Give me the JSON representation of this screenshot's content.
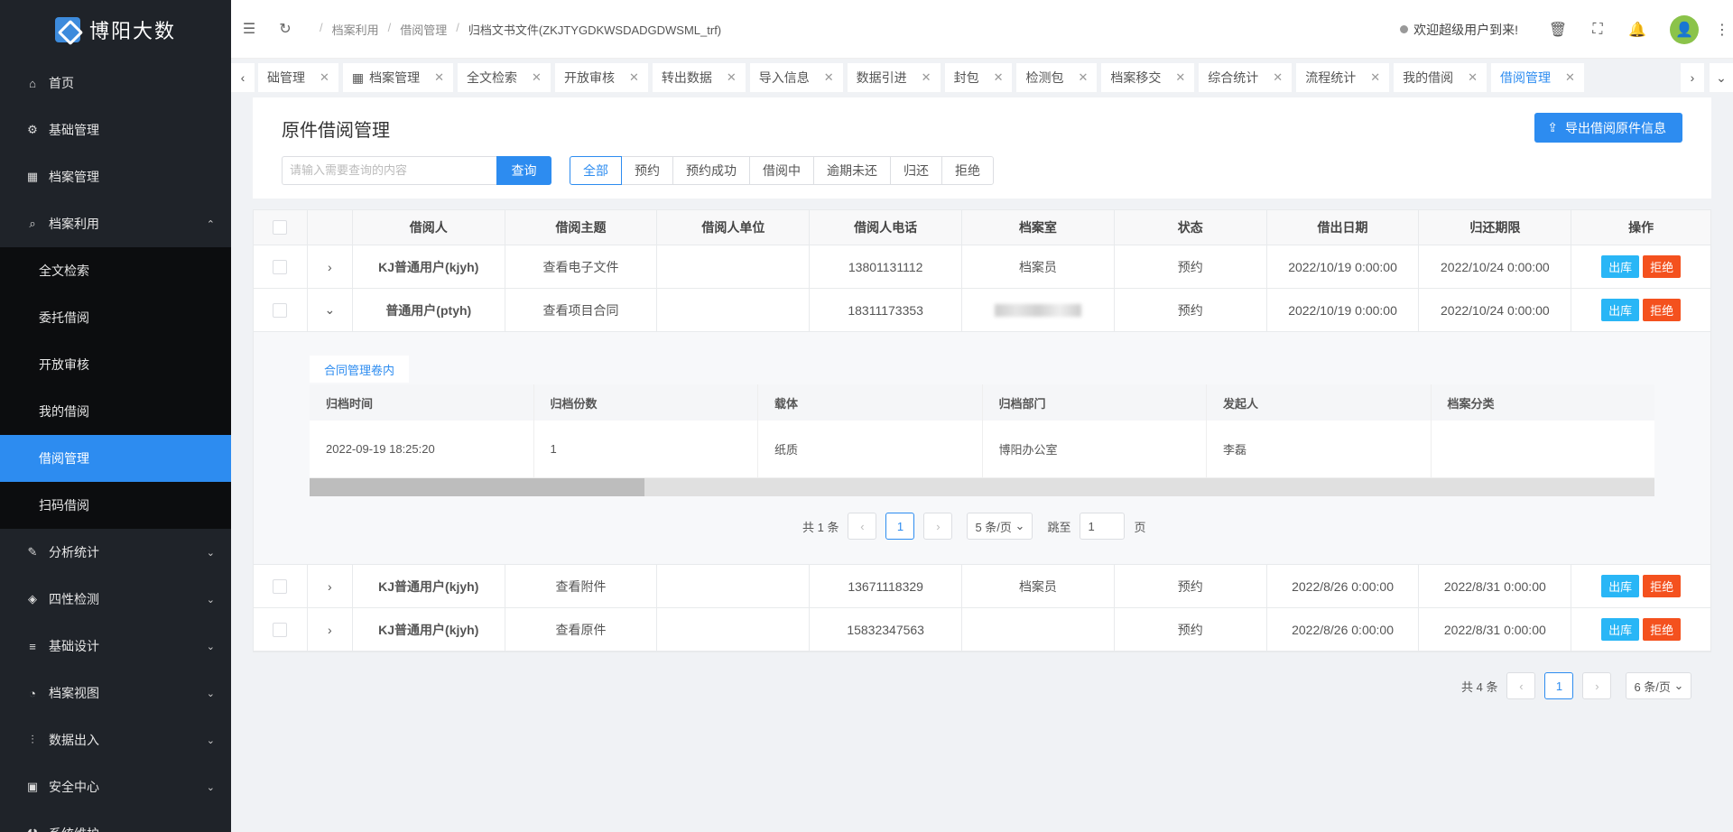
{
  "app": {
    "title": "博阳大数"
  },
  "sidebar": {
    "items": [
      {
        "label": "首页",
        "icon": "home-icon",
        "glyph": "⌂"
      },
      {
        "label": "基础管理",
        "icon": "settings-icon",
        "glyph": "⚙"
      },
      {
        "label": "档案管理",
        "icon": "grid-icon",
        "glyph": "▦"
      },
      {
        "label": "档案利用",
        "icon": "search-icon",
        "glyph": "⌕",
        "expanded": true
      },
      {
        "label": "分析统计",
        "icon": "edit-chart-icon",
        "glyph": "✎"
      },
      {
        "label": "四性检测",
        "icon": "tag-icon",
        "glyph": "◈"
      },
      {
        "label": "基础设计",
        "icon": "list-icon",
        "glyph": "≡"
      },
      {
        "label": "档案视图",
        "icon": "dashboard-icon",
        "glyph": "◔"
      },
      {
        "label": "数据出入",
        "icon": "sliders-icon",
        "glyph": "⫶"
      },
      {
        "label": "安全中心",
        "icon": "briefcase-icon",
        "glyph": "▣"
      },
      {
        "label": "系统维护",
        "icon": "wrench-icon",
        "glyph": "⚒"
      }
    ],
    "sub": [
      "全文检索",
      "委托借阅",
      "开放审核",
      "我的借阅",
      "借阅管理",
      "扫码借阅"
    ]
  },
  "header": {
    "breadcrumbs": [
      "档案利用",
      "借阅管理",
      "归档文书文件(ZKJTYGDKWSDADGDWSML_trf)"
    ],
    "welcome": "欢迎超级用户到来!"
  },
  "tabs": [
    "础管理",
    "档案管理",
    "全文检索",
    "开放审核",
    "转出数据",
    "导入信息",
    "数据引进",
    "封包",
    "检测包",
    "档案移交",
    "综合统计",
    "流程统计",
    "我的借阅",
    "借阅管理"
  ],
  "panel": {
    "title": "原件借阅管理",
    "export_label": "导出借阅原件信息",
    "search_placeholder": "请输入需要查询的内容",
    "query_label": "查询",
    "filters": [
      "全部",
      "预约",
      "预约成功",
      "借阅中",
      "逾期未还",
      "归还",
      "拒绝"
    ]
  },
  "table": {
    "headers": [
      "借阅人",
      "借阅主题",
      "借阅人单位",
      "借阅人电话",
      "档案室",
      "状态",
      "借出日期",
      "归还期限",
      "操作"
    ],
    "rows": [
      {
        "name": "KJ普通用户(kjyh)",
        "subject": "查看电子文件",
        "unit": "",
        "phone": "13801131112",
        "room": "档案员",
        "status": "预约",
        "out": "2022/10/19 0:00:00",
        "due": "2022/10/24 0:00:00"
      },
      {
        "name": "普通用户(ptyh)",
        "subject": "查看项目合同",
        "unit": "",
        "phone": "18311173353",
        "room": "",
        "status": "预约",
        "out": "2022/10/19 0:00:00",
        "due": "2022/10/24 0:00:00"
      },
      {
        "name": "KJ普通用户(kjyh)",
        "subject": "查看附件",
        "unit": "",
        "phone": "13671118329",
        "room": "档案员",
        "status": "预约",
        "out": "2022/8/26 0:00:00",
        "due": "2022/8/31 0:00:00"
      },
      {
        "name": "KJ普通用户(kjyh)",
        "subject": "查看原件",
        "unit": "",
        "phone": "15832347563",
        "room": "",
        "status": "预约",
        "out": "2022/8/26 0:00:00",
        "due": "2022/8/31 0:00:00"
      }
    ],
    "action_out": "出库",
    "action_reject": "拒绝"
  },
  "detail": {
    "tab": "合同管理卷内",
    "headers": [
      "归档时间",
      "归档份数",
      "载体",
      "归档部门",
      "发起人",
      "档案分类"
    ],
    "row": [
      "2022-09-19 18:25:20",
      "1",
      "纸质",
      "博阳办公室",
      "李磊",
      ""
    ],
    "pager": {
      "total": "共 1 条",
      "page": "1",
      "size": "5 条/页",
      "jump": "跳至",
      "jump_value": "1",
      "page_unit": "页"
    }
  },
  "pager": {
    "total": "共 4 条",
    "page": "1",
    "size": "6 条/页"
  }
}
